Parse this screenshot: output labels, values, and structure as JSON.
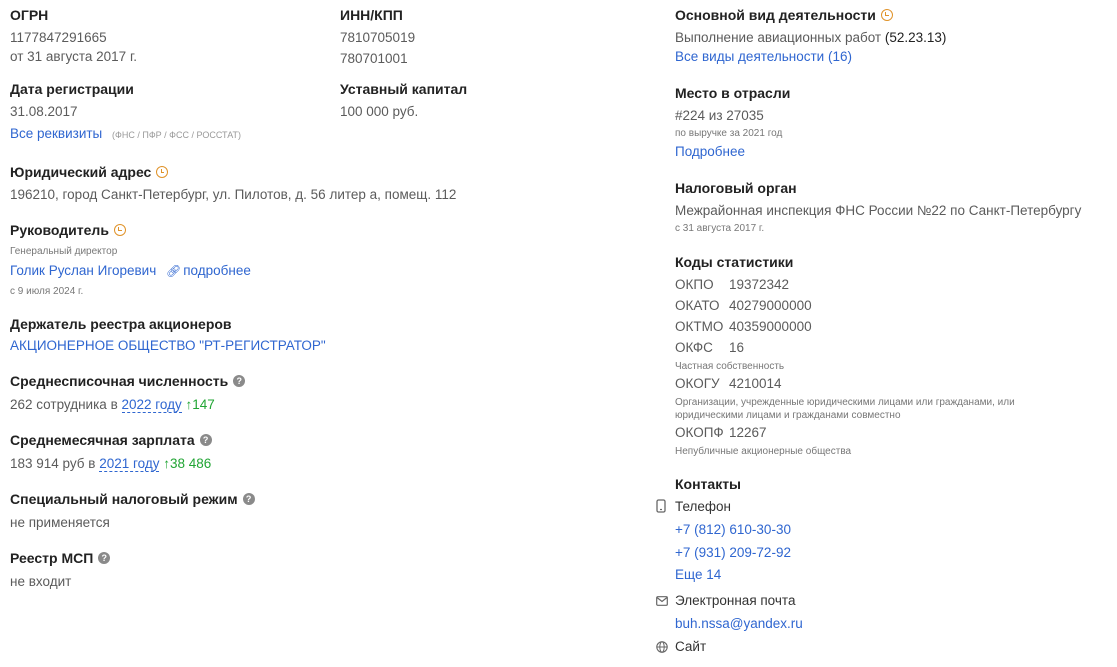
{
  "ogrn": {
    "title": "ОГРН",
    "value": "1177847291665",
    "date": "от 31 августа 2017 г."
  },
  "inn_kpp": {
    "title": "ИНН/КПП",
    "inn": "7810705019",
    "kpp": "780701001"
  },
  "registration": {
    "title": "Дата регистрации",
    "value": "31.08.2017",
    "link": "Все реквизиты",
    "sources": "(ФНС / ПФР / ФСС / РОССТАТ)"
  },
  "capital": {
    "title": "Уставный капитал",
    "value": "100 000 руб."
  },
  "address": {
    "title": "Юридический адрес",
    "value": "196210, город Санкт-Петербург, ул. Пилотов, д. 56 литер а, помещ. 112"
  },
  "director": {
    "title": "Руководитель",
    "position": "Генеральный директор",
    "name": "Голик Руслан Игоревич",
    "more": "подробнее",
    "since": "с 9 июля 2024 г."
  },
  "registry_holder": {
    "title": "Держатель реестра акционеров",
    "value": "АКЦИОНЕРНОЕ ОБЩЕСТВО \"РТ-РЕГИСТРАТОР\""
  },
  "headcount": {
    "title": "Среднесписочная численность",
    "prefix": "262 сотрудника в",
    "year": "2022 году",
    "delta": "↑147",
    "help": "?"
  },
  "salary": {
    "title": "Среднемесячная зарплата",
    "prefix": "183 914 руб в",
    "year": "2021 году",
    "delta": "↑38 486",
    "help": "?"
  },
  "tax_regime": {
    "title": "Специальный налоговый режим",
    "value": "не применяется",
    "help": "?"
  },
  "msp": {
    "title": "Реестр МСП",
    "value": "не входит",
    "help": "?"
  },
  "activity": {
    "title": "Основной вид деятельности",
    "value": "Выполнение авиационных работ",
    "code": "(52.23.13)",
    "all_link": "Все виды деятельности (16)"
  },
  "industry_rank": {
    "title": "Место в отрасли",
    "value": "#224 из 27035",
    "note": "по выручке за 2021 год",
    "link": "Подробнее"
  },
  "tax_authority": {
    "title": "Налоговый орган",
    "value": "Межрайонная инспекция ФНС России №22 по Санкт-Петербургу",
    "since": "с 31 августа 2017 г."
  },
  "stat_codes": {
    "title": "Коды статистики",
    "okpo": {
      "label": "ОКПО",
      "value": "19372342"
    },
    "okato": {
      "label": "ОКАТО",
      "value": "40279000000"
    },
    "oktmo": {
      "label": "ОКТМО",
      "value": "40359000000"
    },
    "okfs": {
      "label": "ОКФС",
      "value": "16",
      "note": "Частная собственность"
    },
    "okogu": {
      "label": "ОКОГУ",
      "value": "4210014",
      "note": "Организации, учрежденные юридическими лицами или гражданами, или юридическими лицами и гражданами совместно"
    },
    "okopf": {
      "label": "ОКОПФ",
      "value": "12267",
      "note": "Непубличные акционерные общества"
    }
  },
  "contacts": {
    "title": "Контакты",
    "phone_label": "Телефон",
    "phones": [
      "+7 (812) 610-30-30",
      "+7 (931) 209-72-92"
    ],
    "more_phones": "Еще 14",
    "email_label": "Электронная почта",
    "email": "buh.nssa@yandex.ru",
    "site_label": "Сайт"
  },
  "icons": {
    "clock": "clock-icon",
    "help": "question-icon",
    "link": "link-icon",
    "phone": "phone-icon",
    "email": "mail-icon",
    "site": "globe-icon"
  },
  "colors": {
    "link": "#2f66d0",
    "growth": "#21a534",
    "clock": "#e0932a"
  }
}
